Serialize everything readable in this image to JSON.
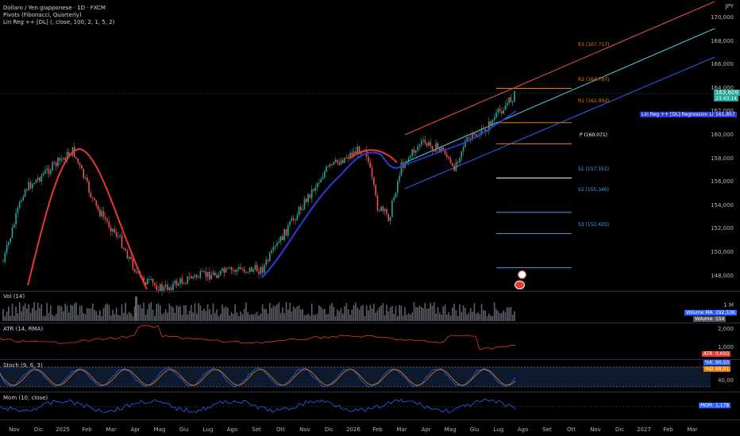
{
  "header": {
    "symbol_line": "Dollaro / Yen giapponese · 1D · FXCM",
    "indicator_pivots": "Pivots (Fibonacci, Quarterly)",
    "indicator_linreg": "Lin Reg ++ [DL] (, close, 100, 2, 1, 5, 2)"
  },
  "price_axis": {
    "currency": "JPY",
    "ticks": [
      "170,000",
      "168,000",
      "166,000",
      "164,000",
      "162,000",
      "160,000",
      "158,000",
      "156,000",
      "154,000",
      "152,000",
      "150,000",
      "148,000"
    ],
    "last_price": "163,609",
    "countdown": "23:43:14",
    "regression_label": "Lin Reg ++ [DL]:Regression Line",
    "regression_value": "161,857"
  },
  "pivots": {
    "r3": "R3 (167.717)",
    "r2": "R2 (164.797)",
    "r1": "R1 (162.992)",
    "p": "P (160.071)",
    "s1": "S1 (157.151)",
    "s2": "S2 (155.346)",
    "s3": "S3 (152.425)"
  },
  "panes": {
    "vol": {
      "title": "Vol (14)",
      "axis": "1 M",
      "ma_label": "Volume MA",
      "ma_value": "192,53K",
      "vol_label": "Volume",
      "vol_value": "154"
    },
    "atr": {
      "title": "ATR (14, RMA)",
      "axis_top": "2,000",
      "axis_bottom": "1,000",
      "label": "ATR",
      "value": "0,650"
    },
    "stoch": {
      "title": "Stoch (9, 6, 3)",
      "k_label": "%K",
      "k_value": "90,50",
      "d_label": "%D",
      "d_value": "88,91",
      "axis": "40,00"
    },
    "mom": {
      "title": "Mom (10, close)",
      "label": "MOM",
      "value": "1,178"
    }
  },
  "time_axis": [
    "Nov",
    "Dic",
    "2025",
    "Feb",
    "Mar",
    "Apr",
    "Mag",
    "Giu",
    "Lug",
    "Ago",
    "Set",
    "Ott",
    "Nov",
    "Dic",
    "2026",
    "Feb",
    "Mar",
    "Apr",
    "Mag",
    "Giu",
    "Lug",
    "Ago",
    "Set",
    "Ott",
    "Nov",
    "Dic",
    "2027",
    "Feb",
    "Mar"
  ],
  "colors": {
    "up": "#26a69a",
    "down": "#ef5350",
    "r_line": "#f57c00",
    "s_line": "#42a5f5",
    "reg_upper": "#ef5350",
    "reg_mid": "#4dd0e1",
    "reg_lower": "#2962ff",
    "ma_red": "#e53935",
    "ma_blue": "#2a3ddb"
  }
}
